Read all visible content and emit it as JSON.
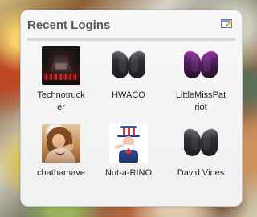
{
  "widget": {
    "title": "Recent Logins",
    "settings_icon": "edit-widget-icon",
    "users": [
      {
        "name": "Technotrucker",
        "avatar_icon": "dark-room-avatar-icon"
      },
      {
        "name": "HWACO",
        "avatar_icon": "default-user-avatar-icon"
      },
      {
        "name": "LittleMissPatriot",
        "avatar_icon": "purple-user-avatar-icon"
      },
      {
        "name": "chathamave",
        "avatar_icon": "girl-photo-avatar-icon"
      },
      {
        "name": "Not-a-RINO",
        "avatar_icon": "uncle-sam-avatar-icon"
      },
      {
        "name": "David Vines",
        "avatar_icon": "default-user-avatar-icon"
      }
    ]
  }
}
